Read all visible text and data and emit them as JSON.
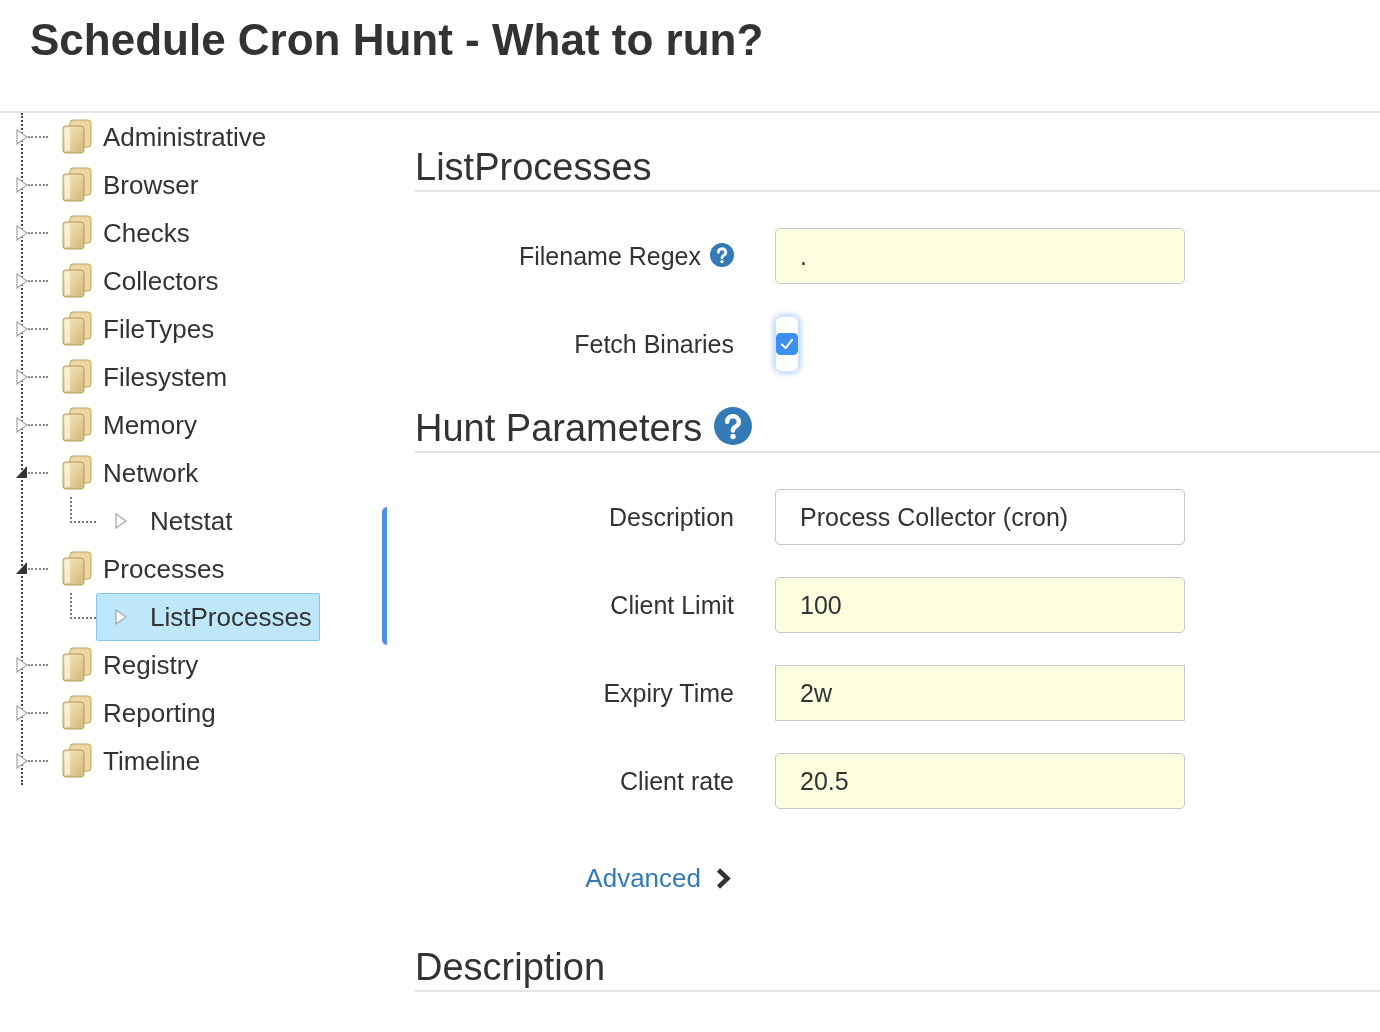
{
  "page": {
    "title": "Schedule Cron Hunt - What to run?"
  },
  "tree": {
    "items": [
      {
        "kind": "folder",
        "label": "Administrative",
        "expanded": false,
        "selected": false
      },
      {
        "kind": "folder",
        "label": "Browser",
        "expanded": false,
        "selected": false
      },
      {
        "kind": "folder",
        "label": "Checks",
        "expanded": false,
        "selected": false
      },
      {
        "kind": "folder",
        "label": "Collectors",
        "expanded": false,
        "selected": false
      },
      {
        "kind": "folder",
        "label": "FileTypes",
        "expanded": false,
        "selected": false
      },
      {
        "kind": "folder",
        "label": "Filesystem",
        "expanded": false,
        "selected": false
      },
      {
        "kind": "folder",
        "label": "Memory",
        "expanded": false,
        "selected": false
      },
      {
        "kind": "folder",
        "label": "Network",
        "expanded": true,
        "selected": false,
        "children": [
          {
            "kind": "flow",
            "label": "Netstat",
            "selected": false
          }
        ]
      },
      {
        "kind": "folder",
        "label": "Processes",
        "expanded": true,
        "selected": false,
        "children": [
          {
            "kind": "flow",
            "label": "ListProcesses",
            "selected": true
          }
        ]
      },
      {
        "kind": "folder",
        "label": "Registry",
        "expanded": false,
        "selected": false
      },
      {
        "kind": "folder",
        "label": "Reporting",
        "expanded": false,
        "selected": false
      },
      {
        "kind": "folder",
        "label": "Timeline",
        "expanded": false,
        "selected": false
      }
    ]
  },
  "flow_form": {
    "title": "ListProcesses",
    "fields": [
      {
        "kind": "text",
        "label": "Filename Regex",
        "help": true,
        "value": ".",
        "highlighted": true
      },
      {
        "kind": "checkbox",
        "label": "Fetch Binaries",
        "help": false,
        "checked": true
      }
    ]
  },
  "hunt_parameters": {
    "title": "Hunt Parameters",
    "help": true,
    "fields": [
      {
        "kind": "text",
        "label": "Description",
        "help": false,
        "value": "Process Collector (cron)",
        "highlighted": false
      },
      {
        "kind": "text",
        "label": "Client Limit",
        "help": false,
        "value": "100",
        "highlighted": true
      },
      {
        "kind": "duration",
        "label": "Expiry Time",
        "help": false,
        "value": "2w",
        "highlighted": true
      },
      {
        "kind": "text",
        "label": "Client rate",
        "help": false,
        "value": "20.5",
        "highlighted": true
      }
    ]
  },
  "advanced_link": {
    "label": "Advanced"
  },
  "description_section": {
    "title": "Description"
  }
}
